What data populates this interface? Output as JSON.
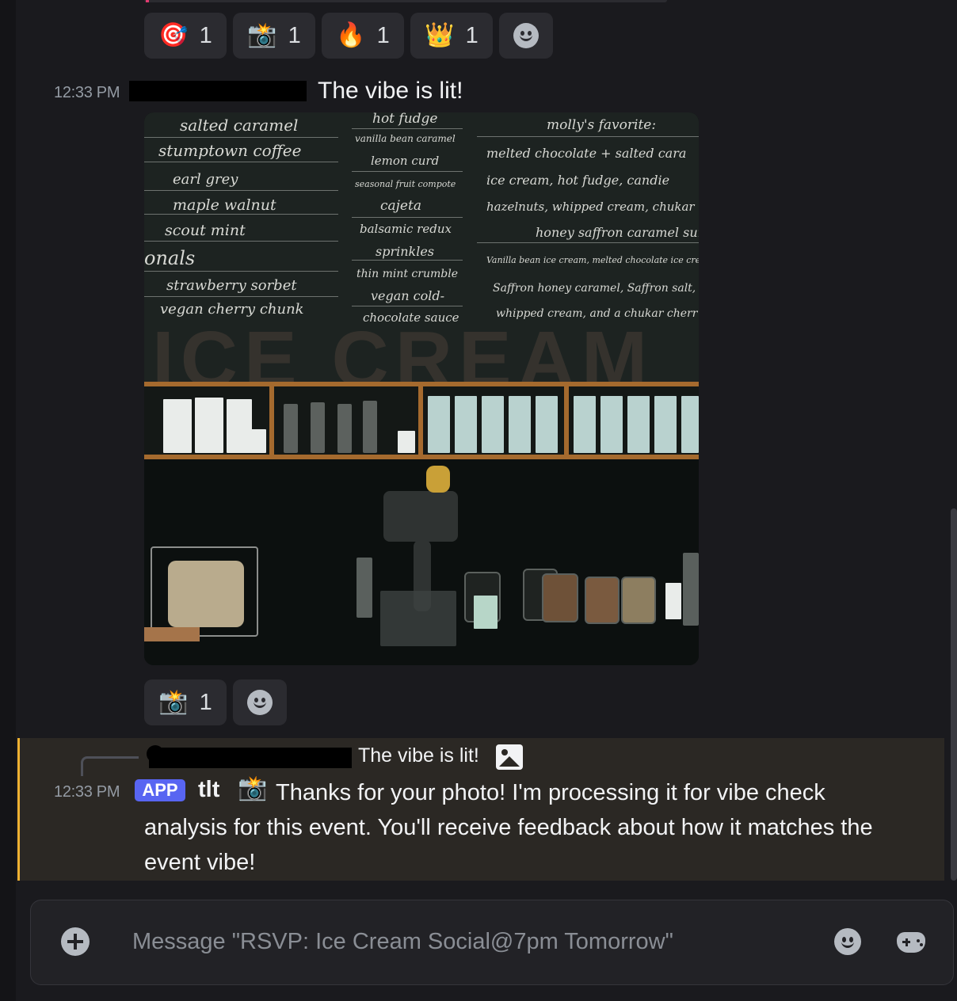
{
  "top_reactions": [
    {
      "emoji": "🎯",
      "count": "1"
    },
    {
      "emoji": "📸",
      "count": "1"
    },
    {
      "emoji": "🔥",
      "count": "1"
    },
    {
      "emoji": "👑",
      "count": "1"
    }
  ],
  "message1": {
    "timestamp": "12:33 PM",
    "text": "The vibe is lit!",
    "reactions": [
      {
        "emoji": "📸",
        "count": "1"
      }
    ]
  },
  "photo": {
    "col1": [
      "salted caramel",
      "stumptown coffee",
      "earl grey",
      "maple walnut",
      "scout mint",
      "onals",
      "strawberry sorbet",
      "vegan cherry chunk"
    ],
    "col2": [
      "hot fudge",
      "vanilla bean caramel",
      "lemon curd",
      "seasonal fruit compote",
      "cajeta",
      "balsamic redux",
      "sprinkles",
      "thin mint crumble",
      "vegan cold-",
      "chocolate sauce"
    ],
    "col3": [
      "molly's favorite:",
      "melted chocolate + salted cara",
      "ice cream, hot fudge, candie",
      "hazelnuts, whipped cream, chukar",
      "honey saffron caramel sunda",
      "Vanilla bean ice cream, melted chocolate ice cre",
      "Saffron honey caramel, Saffron salt,",
      "whipped cream, and a chukar cherr"
    ],
    "wall_letters": "ICE CREAM"
  },
  "bot_message": {
    "reply_text": "The vibe is lit!",
    "timestamp": "12:33 PM",
    "badge": "APP",
    "username": "tlt",
    "emoji": "📸",
    "text": "Thanks for your photo! I'm processing it for vibe check analysis for this event. You'll receive feedback about how it matches the event vibe!"
  },
  "composer": {
    "placeholder": "Message \"RSVP: Ice Cream Social@7pm Tomorrow\""
  },
  "colors": {
    "background": "#1a1a1e",
    "reaction_bg": "#2b2b30",
    "app_badge": "#5865f2",
    "highlight_border": "#f0b232"
  },
  "icons": [
    "add-reaction-icon",
    "image-icon",
    "plus-icon",
    "emoji-icon",
    "gamepad-icon"
  ]
}
